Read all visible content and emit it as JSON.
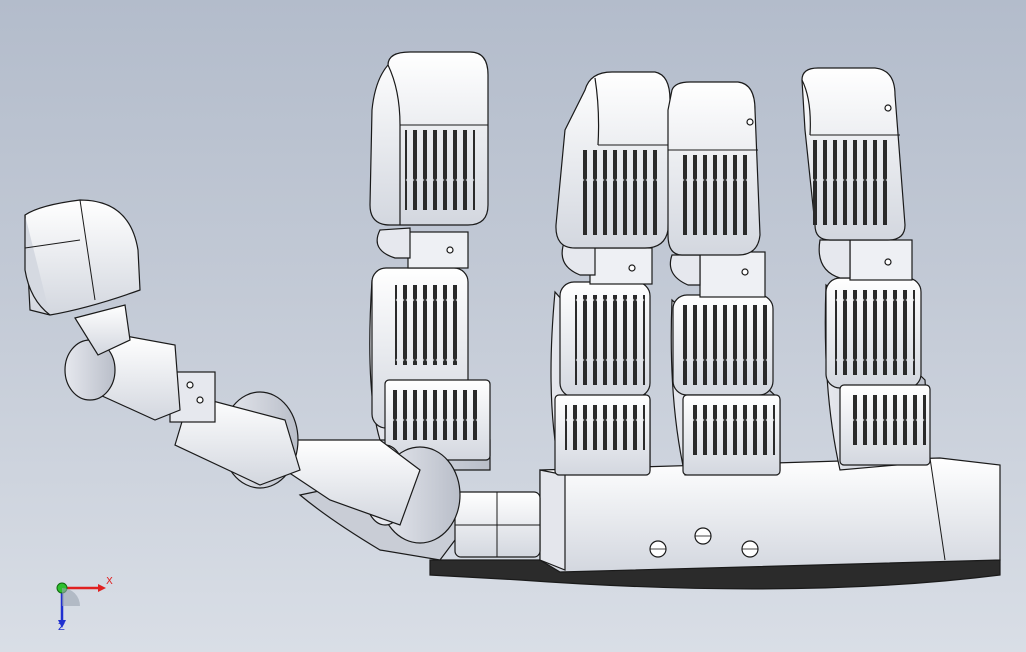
{
  "scene": {
    "background_top": "#b3bccb",
    "background_bottom": "#d9dee6",
    "part_fill": "#f3f4f7",
    "part_shade": "#c9cdd6",
    "edge_color": "#1a1a1a"
  },
  "triad": {
    "x_label": "X",
    "z_label": "Z",
    "x_color": "#e02020",
    "y_color": "#2fbf2f",
    "z_color": "#2030d0"
  },
  "model": {
    "name": "robotic-hand",
    "fingers": [
      "index-finger",
      "middle-finger",
      "ring-finger",
      "little-finger"
    ],
    "thumb": "thumb"
  }
}
